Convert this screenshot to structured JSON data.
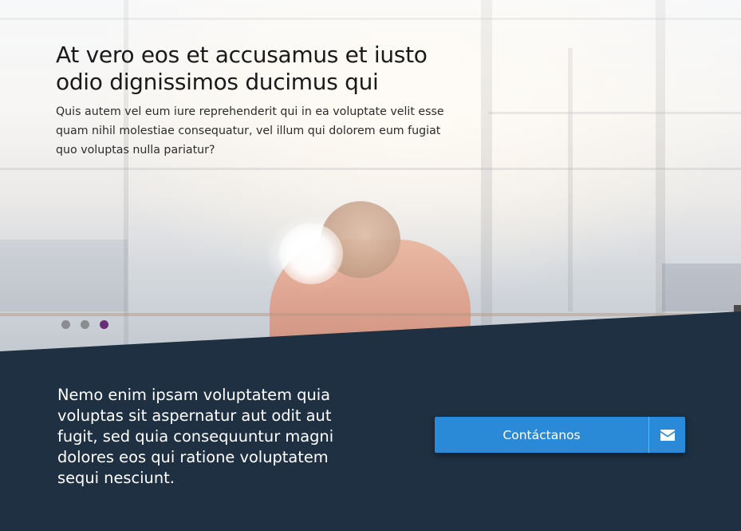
{
  "hero": {
    "title": "At vero eos et accusamus et iusto odio dignissimos ducimus qui",
    "subtitle": "Quis autem vel eum iure reprehenderit qui in ea voluptate velit esse quam nihil molestiae consequatur, vel illum qui dolorem eum fugiat quo voluptas nulla pariatur?",
    "slider": {
      "total": 3,
      "active_index": 3
    }
  },
  "cta": {
    "text": "Nemo enim ipsam voluptatem quia voluptas sit aspernatur aut odit aut fugit, sed quia consequuntur magni dolores eos qui ratione voluptatem sequi nesciunt.",
    "button_label": "Contáctanos",
    "button_icon": "envelope-icon"
  },
  "colors": {
    "band_background": "#1f3042",
    "button": "#2b8ad8",
    "active_dot": "#6b2c79",
    "inactive_dot": "#8b8c8f"
  }
}
